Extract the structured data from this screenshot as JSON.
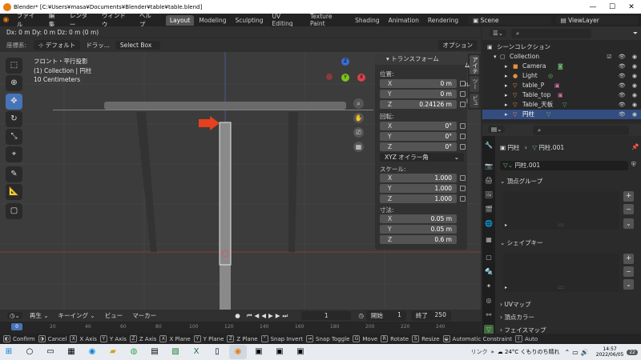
{
  "titlebar": {
    "title": "Blender* [C:¥Users¥masa¥Documents¥Blender¥table¥table.blend]",
    "minimize": "—",
    "maximize": "☐",
    "close": "✕"
  },
  "menu": [
    "ファイル",
    "編集",
    "レンダー",
    "ウィンドウ",
    "ヘルプ"
  ],
  "workspace_tabs": [
    "Layout",
    "Modeling",
    "Sculpting",
    "UV Editing",
    "Texture Paint",
    "Shading",
    "Animation",
    "Rendering"
  ],
  "scene": "Scene",
  "viewlayer": "ViewLayer",
  "vp_header": {
    "delta": "Dx: 0 m   Dy: 0 m   Dz: 0 m (0 m)",
    "axis_label": "座標系:",
    "orientation": "デフォルト",
    "drag": "ドラッ...",
    "select": "Select Box",
    "options": "オプション"
  },
  "view_info": {
    "line1": "フロント・平行投影",
    "line2": "(1) Collection | 円柱",
    "line3": "10 Centimeters"
  },
  "gizmo": {
    "z": "Z",
    "y": "Y",
    "x": "X"
  },
  "npanel": {
    "title": "トランスフォーム",
    "location_label": "位置:",
    "loc": [
      {
        "k": "X",
        "v": "0 m"
      },
      {
        "k": "Y",
        "v": "0 m"
      },
      {
        "k": "Z",
        "v": "0.24126 m"
      }
    ],
    "rotation_label": "回転:",
    "rot": [
      {
        "k": "X",
        "v": "0°"
      },
      {
        "k": "Y",
        "v": "0°"
      },
      {
        "k": "Z",
        "v": "0°"
      }
    ],
    "rot_mode": "XYZ オイラー角",
    "scale_label": "スケール:",
    "scale": [
      {
        "k": "X",
        "v": "1.000"
      },
      {
        "k": "Y",
        "v": "1.000"
      },
      {
        "k": "Z",
        "v": "1.000"
      }
    ],
    "dims_label": "寸法:",
    "dims": [
      {
        "k": "X",
        "v": "0.05 m"
      },
      {
        "k": "Y",
        "v": "0.05 m"
      },
      {
        "k": "Z",
        "v": "0.6 m"
      }
    ]
  },
  "side_tabs": [
    "アイテム",
    "ツール",
    "ビュー"
  ],
  "outliner": {
    "header": "シーンコレクション",
    "items": [
      {
        "label": "Collection"
      },
      {
        "label": "Camera"
      },
      {
        "label": "Light"
      },
      {
        "label": "table_P"
      },
      {
        "label": "Table_top"
      },
      {
        "label": "Table_天板"
      },
      {
        "label": "円柱"
      }
    ]
  },
  "props": {
    "object": "円柱",
    "mesh": "円柱.001",
    "mesh_field": "円柱.001",
    "vgroups": "頂点グループ",
    "shapekeys": "シェイプキー",
    "uvmaps": "UVマップ",
    "vcolors": "頂点カラー",
    "facemaps": "フェイスマップ",
    "dots": "::::"
  },
  "timeline": {
    "playback": "再生",
    "keying": "キーイング",
    "view": "ビュー",
    "marker": "マーカー",
    "frame": "1",
    "start_label": "開始",
    "start": "1",
    "end_label": "終了",
    "end": "250"
  },
  "ruler": [
    "0",
    "20",
    "40",
    "60",
    "80",
    "100",
    "120",
    "140",
    "160",
    "180",
    "200",
    "220",
    "240"
  ],
  "status": [
    {
      "key": "Confirm"
    },
    {
      "key": "Cancel"
    },
    {
      "key": "X Axis"
    },
    {
      "key": "Y Axis"
    },
    {
      "key": "Z Axis"
    },
    {
      "key": "X Plane"
    },
    {
      "key": "Y Plane"
    },
    {
      "key": "Z Plane"
    },
    {
      "key": "Snap Invert"
    },
    {
      "key": "Snap Toggle"
    },
    {
      "key": "Move"
    },
    {
      "key": "Rotate"
    },
    {
      "key": "Resize"
    },
    {
      "key": "Automatic Constraint"
    },
    {
      "key": "Auto"
    }
  ],
  "status_keys": [
    "X",
    "Y",
    "Z",
    "X",
    "Y",
    "Z",
    "G",
    "R",
    "S"
  ],
  "taskbar": {
    "link": "リンク",
    "weather": "24°C くもりのち晴れ",
    "time": "14:57",
    "date": "2022/06/05",
    "notif": "22"
  }
}
